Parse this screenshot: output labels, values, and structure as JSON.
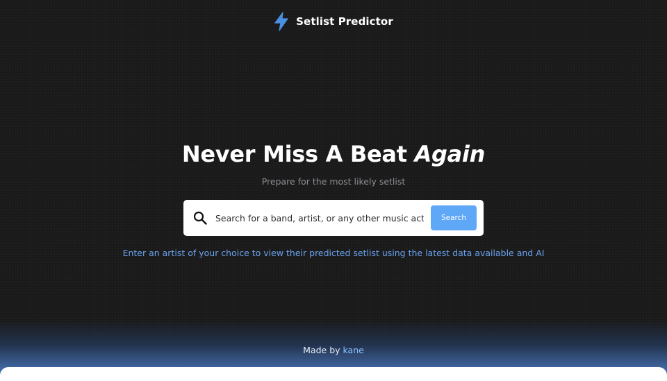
{
  "header": {
    "brand": "Setlist Predictor",
    "logo_icon": "lightning-bolt-icon",
    "accent_color": "#4a90e2"
  },
  "hero": {
    "title_main": "Never Miss A Beat ",
    "title_accent": "Again",
    "subtitle": "Prepare for the most likely setlist"
  },
  "search": {
    "icon": "search-icon",
    "value": "",
    "placeholder": "Search for a band, artist, or any other music act",
    "button_label": "Search",
    "button_color": "#5ea8f7"
  },
  "hint": {
    "text": "Enter an artist of your choice to view their predicted setlist using the latest data available and AI",
    "color": "#6aa2ee"
  },
  "footer": {
    "made_by_prefix": "Made by ",
    "author": "kane",
    "link_color": "#8cc3ff"
  }
}
